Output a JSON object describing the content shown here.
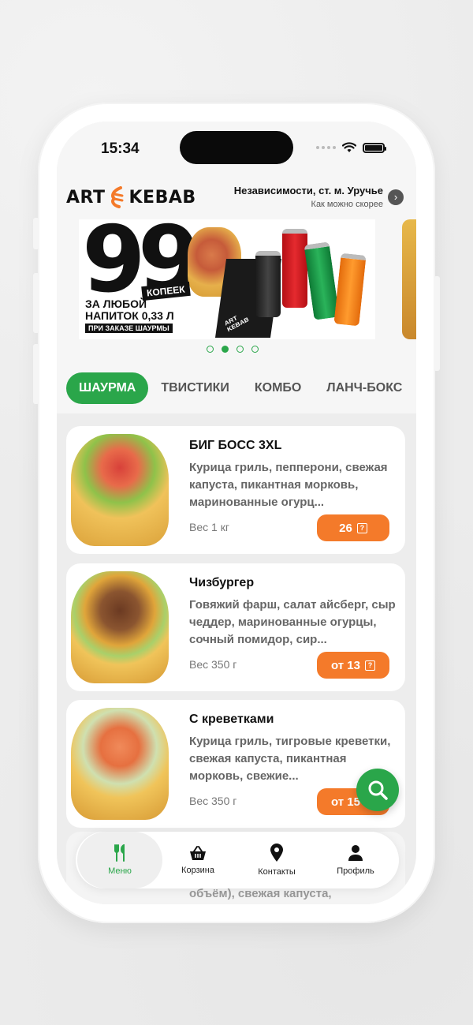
{
  "status_bar": {
    "time": "15:34"
  },
  "header": {
    "logo_left": "ART",
    "logo_right": "KEBAB",
    "address": "Независимости, ст. м. Уручье",
    "delivery_time": "Как можно скорее",
    "address_arrow": "chevron-right-icon"
  },
  "banner": {
    "big_number": "99",
    "badge": "КОПЕЕК",
    "line1": "ЗА ЛЮБОЙ",
    "line2": "НАПИТОК  0,33 Л",
    "pill": "ПРИ ЗАКАЗЕ ШАУРМЫ",
    "box_text": "ART KEBAB",
    "page_count": 4,
    "active_page": 2
  },
  "tabs": [
    {
      "label": "ШАУРМА",
      "active": true
    },
    {
      "label": "ТВИСТИКИ",
      "active": false
    },
    {
      "label": "КОМБО",
      "active": false
    },
    {
      "label": "ЛАНЧ-БОКС",
      "active": false
    }
  ],
  "products": [
    {
      "title": "БИГ БОСС 3XL",
      "description": "Курица гриль, пепперони, свежая  капуста, пикантная морковь, маринованные огурц...",
      "weight": "Вес 1 кг",
      "price": "26"
    },
    {
      "title": "Чизбургер",
      "description": "Говяжий фарш, салат айсберг, сыр чеддер, маринованные огурцы, сочный помидор, сир...",
      "weight": "Вес 350 г",
      "price": "от 13"
    },
    {
      "title": "С креветками",
      "description": "Курица гриль, тигровые креветки, свежая капуста, пикантная морковь, свежие...",
      "weight": "Вес 350 г",
      "price": "от 15"
    }
  ],
  "peek_text": "объём), свежая капуста,",
  "bottom_nav": [
    {
      "label": "Меню",
      "icon": "fork-knife-icon",
      "active": true
    },
    {
      "label": "Корзина",
      "icon": "basket-icon",
      "active": false
    },
    {
      "label": "Контакты",
      "icon": "map-pin-icon",
      "active": false
    },
    {
      "label": "Профиль",
      "icon": "person-icon",
      "active": false
    }
  ],
  "colors": {
    "accent_green": "#2aa64a",
    "accent_orange": "#f47a2a"
  }
}
